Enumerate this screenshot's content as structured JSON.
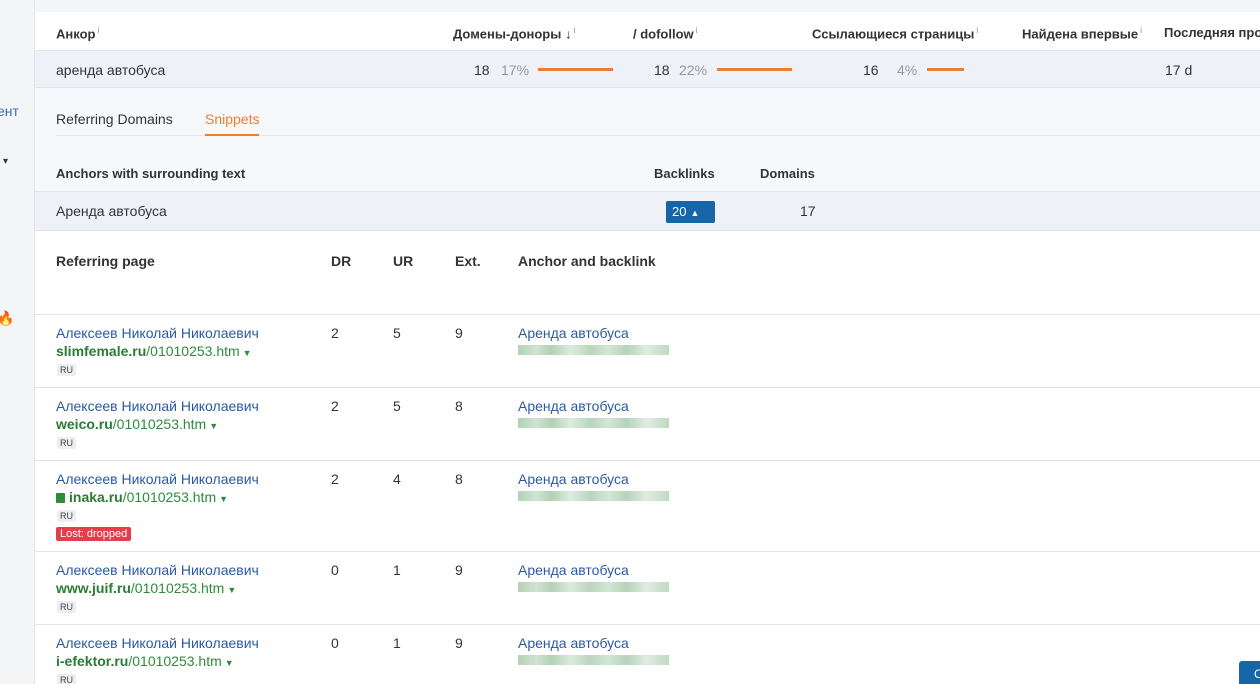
{
  "sidebar": {
    "partial_text": "ент",
    "caret": "▾",
    "fire": "🔥"
  },
  "anchors_table": {
    "headers": {
      "anchor": "Анкор",
      "domains": "Домены-доноры",
      "sort_arrow": "↓",
      "dofollow": "/ dofollow",
      "ref_pages": "Ссылающиеся страницы",
      "first_seen": "Найдена впервые",
      "last": "Последняя про",
      "info": "i"
    },
    "row": {
      "anchor": "аренда автобуса",
      "domains": "18",
      "domains_pct": "17%",
      "dofollow": "18",
      "dofollow_pct": "22%",
      "ref_pages": "16",
      "ref_pages_pct": "4%",
      "last": "17 d"
    },
    "bar_percent": {
      "domains": 100,
      "dofollow": 100,
      "ref_pages": 50
    },
    "accent_color": "#ee7d31"
  },
  "tabs": [
    {
      "label": "Referring Domains"
    },
    {
      "label": "Snippets"
    }
  ],
  "snippets": {
    "headers": {
      "anchors": "Anchors with surrounding text",
      "backlinks": "Backlinks",
      "domains": "Domains"
    },
    "row": {
      "text": "Аренда автобуса",
      "backlinks": "20",
      "domains": "17"
    }
  },
  "backlinks": {
    "headers": {
      "page": "Referring page",
      "dr": "DR",
      "ur": "UR",
      "ext": "Ext.",
      "anchor": "Anchor and backlink"
    },
    "rows": [
      {
        "title": "Алексеев Николай Николаевич",
        "domain": "slimfemale.ru",
        "path": "/01010253.htm",
        "lang": "RU",
        "dr": "2",
        "ur": "5",
        "ext": "9",
        "anchor": "Аренда автобуса"
      },
      {
        "title": "Алексеев Николай Николаевич",
        "domain": "weico.ru",
        "path": "/01010253.htm",
        "lang": "RU",
        "dr": "2",
        "ur": "5",
        "ext": "8",
        "anchor": "Аренда автобуса"
      },
      {
        "title": "Алексеев Николай Николаевич",
        "domain": "inaka.ru",
        "path": "/01010253.htm",
        "lang": "RU",
        "dr": "2",
        "ur": "4",
        "ext": "8",
        "anchor": "Аренда автобуса",
        "badge": "Lost: dropped"
      },
      {
        "title": "Алексеев Николай Николаевич",
        "domain": "www.juif.ru",
        "path": "/01010253.htm",
        "lang": "RU",
        "dr": "0",
        "ur": "1",
        "ext": "9",
        "anchor": "Аренда автобуса"
      },
      {
        "title": "Алексеев Николай Николаевич",
        "domain": "i-efektor.ru",
        "path": "/01010253.htm",
        "lang": "RU",
        "dr": "0",
        "ur": "1",
        "ext": "9",
        "anchor": "Аренда автобуса"
      }
    ]
  },
  "corner_button": {
    "label": "С"
  }
}
